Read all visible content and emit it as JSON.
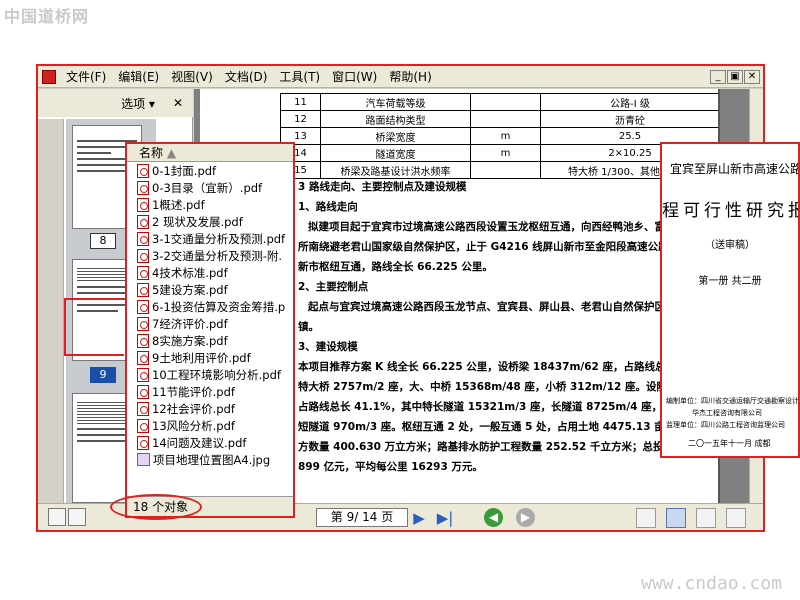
{
  "watermark_top": "中国道桥网",
  "watermark_bottom": "www.cndao.com",
  "menu": [
    "文件(F)",
    "编辑(E)",
    "视图(V)",
    "文档(D)",
    "工具(T)",
    "窗口(W)",
    "帮助(H)"
  ],
  "window_buttons": [
    "_",
    "▣",
    "✕"
  ],
  "nav": {
    "options_label": "选项 ▾",
    "close_label": "✕"
  },
  "thumb_pages": [
    "8",
    "9"
  ],
  "table_rows": [
    [
      "11",
      "汽车荷载等级",
      "",
      "公路-I 级"
    ],
    [
      "12",
      "路面结构类型",
      "",
      "沥青砼"
    ],
    [
      "13",
      "桥梁宽度",
      "m",
      "25.5"
    ],
    [
      "14",
      "隧道宽度",
      "m",
      "2×10.25"
    ],
    [
      "15",
      "桥梁及路基设计洪水频率",
      "",
      "特大桥 1/300、其他 1/100"
    ]
  ],
  "doc_lines": [
    "3 路线走向、主要控制点及建设规模",
    "1、路线走向",
    "拟建项目起于宜宾市过境高速公路西段设置玉龙枢纽互通，向西经鸭池乡、富",
    "所南绕避老君山国家级自然保护区，止于 G4216 线屏山新市至金阳段高速公路",
    "新市枢纽互通，路线全长 66.225 公里。",
    "2、主要控制点",
    "起点与宜宾过境高速公路西段玉龙节点、宜宾县、屏山县、老君山自然保护区",
    "镇。",
    "3、建设规模",
    "本项目推荐方案 K 线全长 66.225 公里，设桥梁 18437m/62 座，占路线总长 27.8",
    "特大桥 2757m/2 座，大、中桥 15368m/48 座，小桥 312m/12 座。设隧道 27198m/",
    "占路线总长 41.1%，其中特长隧道 15321m/3 座，长隧道 8725m/4 座，中隧道 2182m",
    "短隧道 970m/3 座。枢纽互通 2 处，一般互通 5 处，占用土地 4475.13 亩，路",
    "方数量 400.630 万立方米；路基排水防护工程数量 252.52 千立方米；总投资",
    "899 亿元，平均每公里 16293 万元。"
  ],
  "file_list": {
    "header": "名称",
    "files": [
      "0-1封面.pdf",
      "0-3目录（宜新）.pdf",
      "1概述.pdf",
      "2 现状及发展.pdf",
      "3-1交通量分析及预测.pdf",
      "3-2交通量分析及预测-附.",
      "4技术标准.pdf",
      "5建设方案.pdf",
      "6-1投资估算及资金筹措.p",
      "7经济评价.pdf",
      "8实施方案.pdf",
      "9土地利用评价.pdf",
      "10工程环境影响分析.pdf",
      "11节能评价.pdf",
      "12社会评价.pdf",
      "13风险分析.pdf",
      "14问题及建议.pdf",
      "项目地理位置图A4.jpg"
    ],
    "status": "18 个对象"
  },
  "pager": {
    "text": "第 9/ 14 页"
  },
  "cover": {
    "line1": "宜宾至屏山新市高速公路",
    "line2": "程可行性研究报",
    "line3": "（送审稿）",
    "line4": "第一册   共二册",
    "small1": "编制单位：四川省交通运输厅交通勘察设计研",
    "small2": "华杰工程咨询有限公司",
    "small3": "监理单位：四川公路工程咨询监理公司",
    "date": "二〇一五年十一月    成都"
  }
}
